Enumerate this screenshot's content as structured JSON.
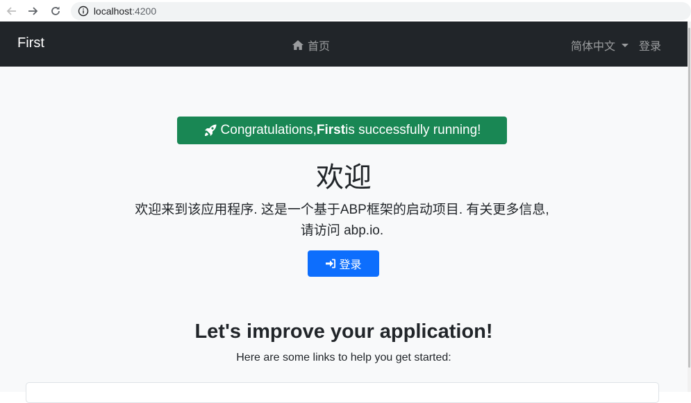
{
  "browser": {
    "url_host": "localhost",
    "url_port": ":4200"
  },
  "navbar": {
    "brand": "First",
    "home_label": "首页",
    "language_label": "简体中文",
    "login_label": "登录"
  },
  "alert": {
    "prefix": "Congratulations, ",
    "app_name": "First",
    "suffix": " is successfully running!"
  },
  "welcome": {
    "title": "欢迎",
    "line1": "欢迎来到该应用程序. 这是一个基于ABP框架的启动项目. 有关更多信息,",
    "line2": "请访问 abp.io.",
    "login_button": "登录"
  },
  "improve": {
    "title": "Let's improve your application!",
    "subtitle": "Here are some links to help you get started:"
  },
  "colors": {
    "navbar_bg": "#212529",
    "success": "#198754",
    "primary": "#0d6efd",
    "page_bg": "#f8f9fa"
  }
}
